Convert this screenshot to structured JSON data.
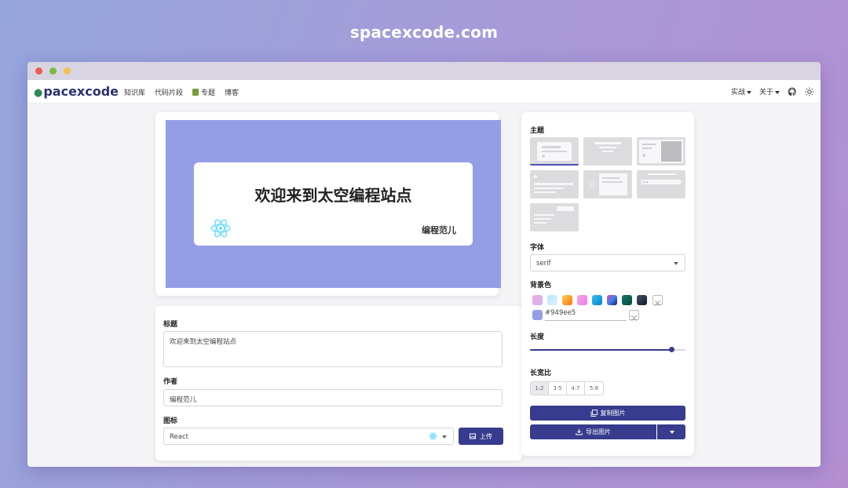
{
  "site_title": "spacexcode.com",
  "navbar": {
    "logo": "pacexcode",
    "links": [
      "知识库",
      "代码片段",
      "专题",
      "博客"
    ],
    "right_links": [
      "实战",
      "关于"
    ]
  },
  "preview": {
    "background": "#949ee5",
    "title": "欢迎来到太空编程站点",
    "author": "编程范儿",
    "icon": "react-icon"
  },
  "form": {
    "title_label": "标题",
    "title_value": "欢迎来到太空编程站点",
    "author_label": "作者",
    "author_value": "编程范儿",
    "icon_label": "图标",
    "icon_value": "React",
    "upload_label": "上传"
  },
  "settings": {
    "theme_label": "主题",
    "font_label": "字体",
    "font_value": "serif",
    "bg_label": "背景色",
    "bg_hex": "#949ee5",
    "length_label": "长度",
    "length_value": 0.91,
    "ratio_label": "长宽比",
    "ratios": [
      "1:2",
      "3:5",
      "4:7",
      "5:8"
    ],
    "copy_label": "复制图片",
    "export_label": "导出图片",
    "swatches": [
      "linear-gradient(135deg,#f9a8d4,#c4b5fd)",
      "linear-gradient(135deg,#bae6fd,#e0f2fe)",
      "linear-gradient(135deg,#fcd34d,#f97316)",
      "linear-gradient(135deg,#f9a8d4,#e879f9)",
      "linear-gradient(135deg,#38bdf8,#0284c7)",
      "linear-gradient(135deg,#ec4899,#3b82f6,#1e1b4b)",
      "linear-gradient(135deg,#0f766e,#064e3b)",
      "linear-gradient(135deg,#475569,#0f172a)"
    ]
  }
}
